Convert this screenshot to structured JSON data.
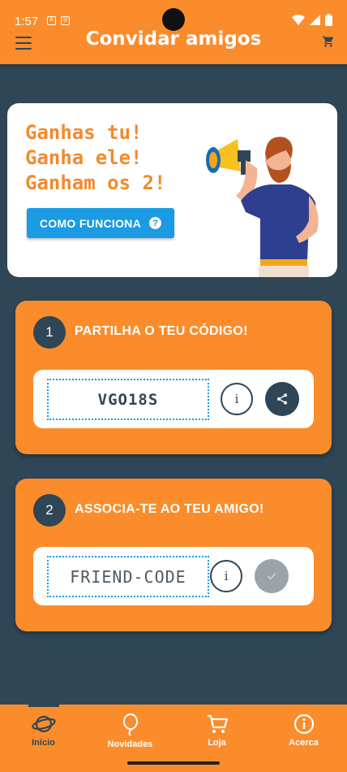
{
  "status_bar": {
    "time": "1:57"
  },
  "app_bar": {
    "title": "Convidar amigos",
    "menu_icon": "hamburger-menu-icon",
    "cart_icon": "shopping-cart-icon"
  },
  "promo": {
    "line1": "Ganhas tu!",
    "line2": "Ganha ele!",
    "line3": "Ganham os 2!",
    "button_label": "COMO FUNCIONA",
    "button_icon": "help-circle-icon",
    "illustration": "man-with-megaphone"
  },
  "step1": {
    "number": "1",
    "title": "PARTILHA O TEU CÓDIGO!",
    "code": "VGO18S",
    "info_icon": "info-icon",
    "action_icon": "share-icon"
  },
  "step2": {
    "number": "2",
    "title": "ASSOCIA-TE AO TEU AMIGO!",
    "placeholder": "FRIEND-CODE",
    "info_icon": "info-icon",
    "action_icon": "check-icon"
  },
  "bottom_nav": {
    "items": [
      {
        "label": "Início",
        "icon": "planet-icon",
        "active": true
      },
      {
        "label": "Novidades",
        "icon": "balloon-icon",
        "active": false
      },
      {
        "label": "Loja",
        "icon": "cart-icon",
        "active": false
      },
      {
        "label": "Acerca",
        "icon": "info-circle-icon",
        "active": false
      }
    ]
  },
  "colors": {
    "primary_orange": "#fb8c2b",
    "dark_slate": "#2f4656",
    "accent_blue": "#1a9be3",
    "disabled_grey": "#9aa3a8",
    "headline_orange": "#f28a2c"
  }
}
